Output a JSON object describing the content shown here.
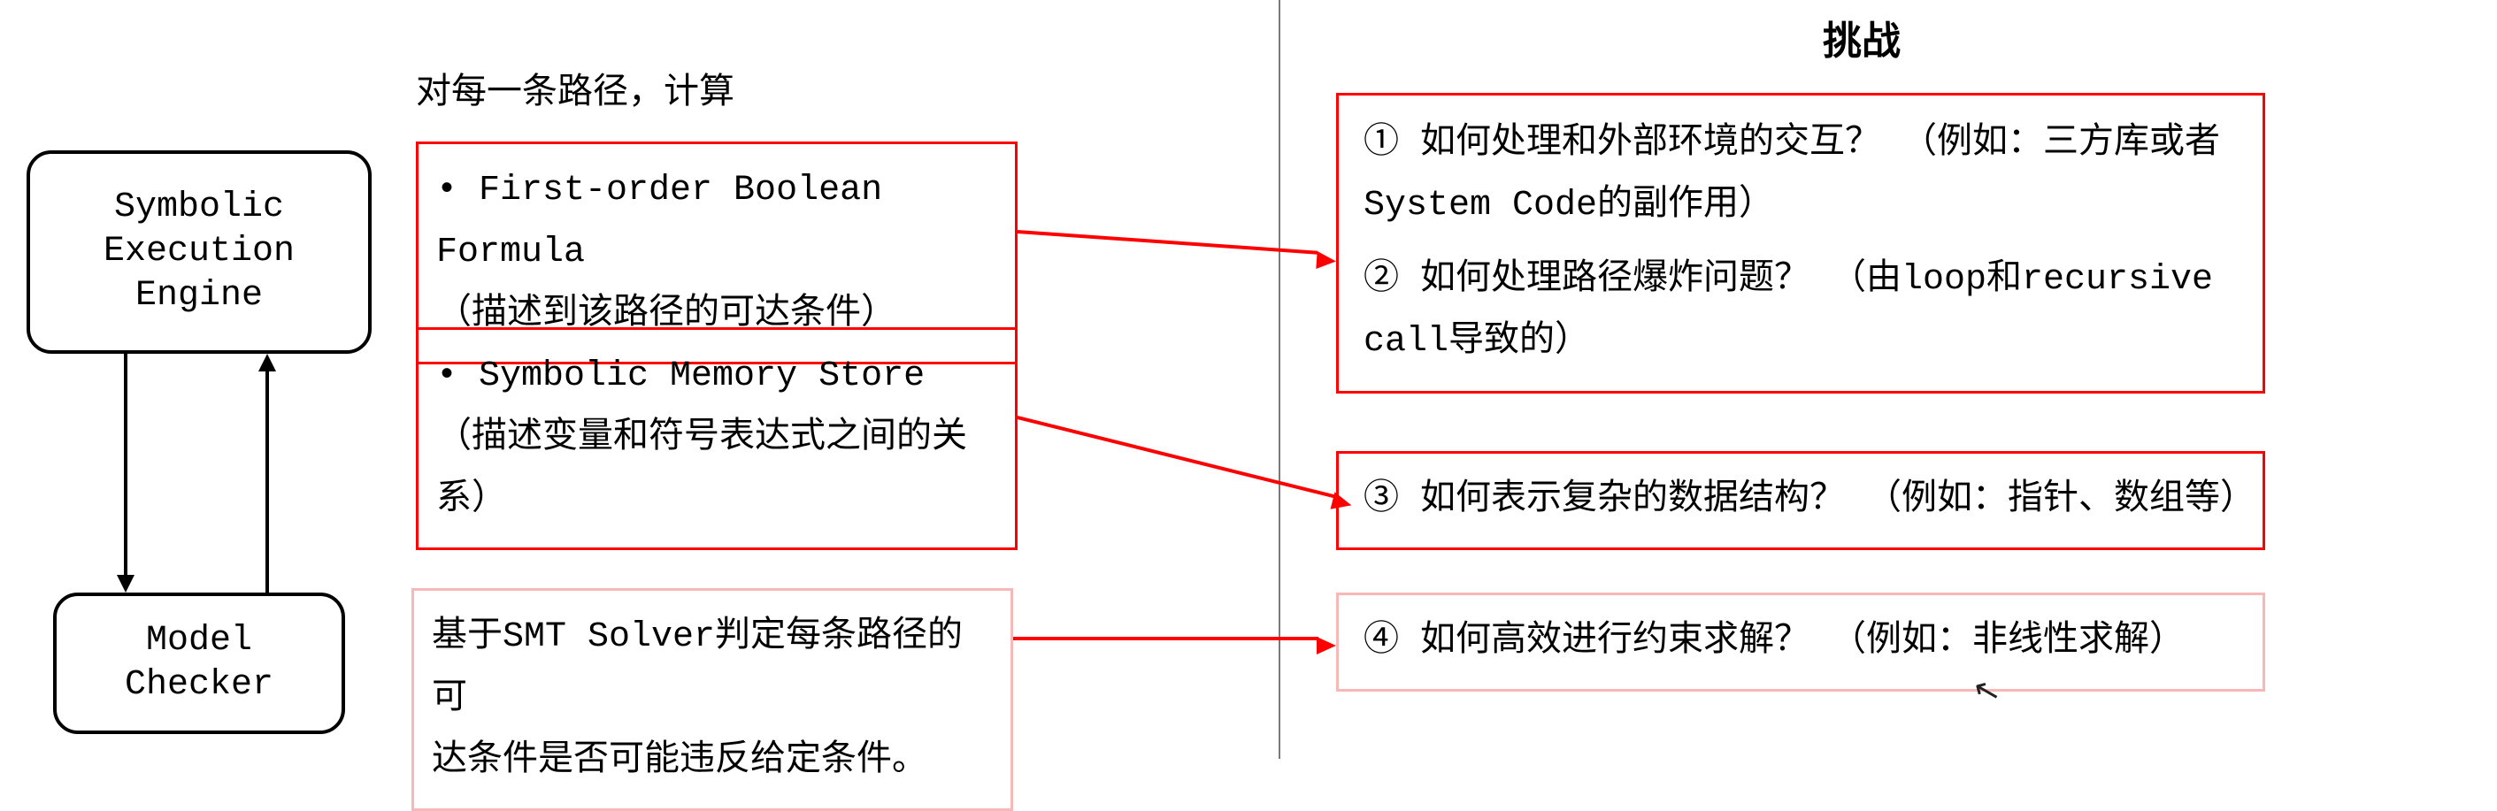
{
  "left": {
    "engine_label": "Symbolic\nExecution\nEngine",
    "checker_label": "Model\nChecker",
    "path_intro": "对每一条路径，计算",
    "box1_line1": "•  First-order Boolean Formula",
    "box1_line2": "（描述到该路径的可达条件）",
    "box2_line1": "•  Symbolic Memory Store",
    "box2_line2": "（描述变量和符号表达式之间的关系）",
    "box3_line1": "基于SMT Solver判定每条路径的可",
    "box3_line2": "达条件是否可能违反给定条件。"
  },
  "right": {
    "heading": "挑战",
    "c1": "①  如何处理和外部环境的交互？ （例如：三方库或者System Code的副作用）",
    "c2": "②  如何处理路径爆炸问题？ （由loop和recursive call导致的）",
    "c3": "③  如何表示复杂的数据结构？ （例如：指针、数组等）",
    "c4": "④  如何高效进行约束求解？ （例如：非线性求解）"
  },
  "colors": {
    "red": "#ff0000",
    "light_red": "#f9b8b8",
    "divider": "#7a7a7a"
  }
}
